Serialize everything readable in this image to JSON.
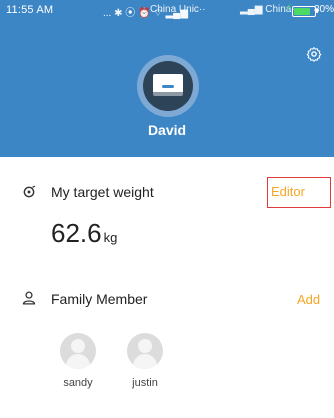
{
  "status_bar": {
    "time": "11:55 AM",
    "icons_text": "... ✱ ⦿ ⏰ ⌔ ▂▄▆",
    "carrier1": "China Unic··",
    "carrier2": "▂▄▆ China··",
    "battery_percent": "80%",
    "battery_level": 0.8
  },
  "header": {
    "background_color": "#3d86c6",
    "username": "David",
    "settings_icon": "gear-icon"
  },
  "target_weight": {
    "title": "My target weight",
    "action_label": "Editor",
    "value": "62.6",
    "unit": "kg",
    "icon": "target-icon"
  },
  "family": {
    "title": "Family Member",
    "action_label": "Add",
    "icon": "person-icon",
    "members": [
      {
        "name": "sandy"
      },
      {
        "name": "justin"
      }
    ]
  },
  "colors": {
    "accent": "#f5a623",
    "highlight_box": "#e03a3a"
  }
}
